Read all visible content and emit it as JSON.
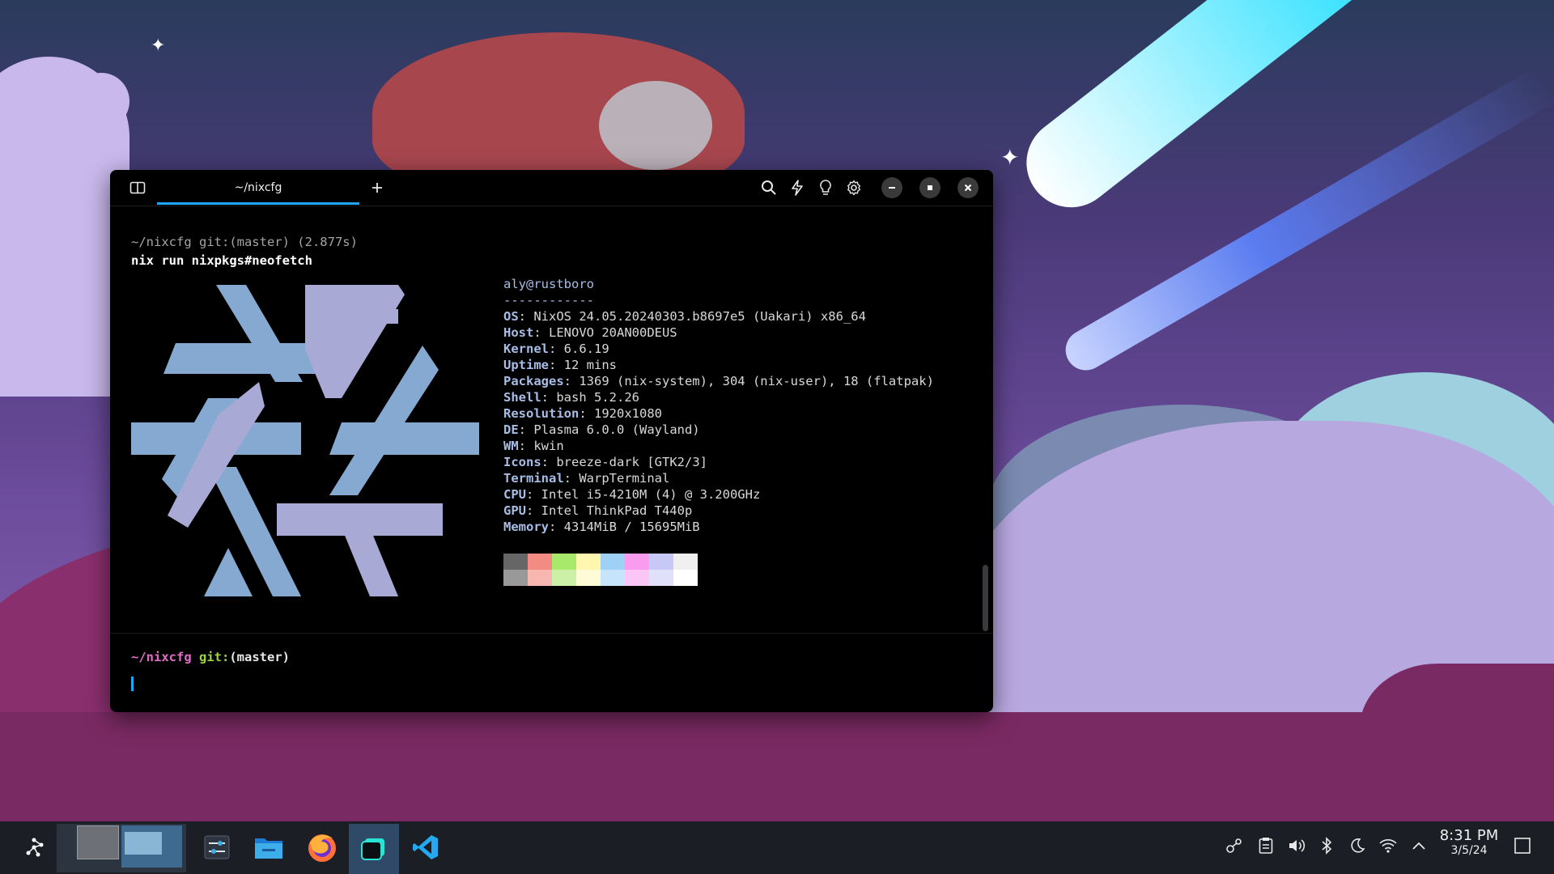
{
  "terminal": {
    "tab_title": "~/nixcfg",
    "previous_block_header": "~/nixcfg git:(master) (2.877s)",
    "command": "nix run nixpkgs#neofetch",
    "info": {
      "header": "aly@rustboro",
      "separator": "------------",
      "rows": [
        {
          "key": "OS",
          "value": "NixOS 24.05.20240303.b8697e5 (Uakari) x86_64"
        },
        {
          "key": "Host",
          "value": "LENOVO 20AN00DEUS"
        },
        {
          "key": "Kernel",
          "value": "6.6.19"
        },
        {
          "key": "Uptime",
          "value": "12 mins"
        },
        {
          "key": "Packages",
          "value": "1369 (nix-system), 304 (nix-user), 18 (flatpak)"
        },
        {
          "key": "Shell",
          "value": "bash 5.2.26"
        },
        {
          "key": "Resolution",
          "value": "1920x1080"
        },
        {
          "key": "DE",
          "value": "Plasma 6.0.0 (Wayland)"
        },
        {
          "key": "WM",
          "value": "kwin"
        },
        {
          "key": "Icons",
          "value": "breeze-dark [GTK2/3]"
        },
        {
          "key": "Terminal",
          "value": "WarpTerminal"
        },
        {
          "key": "CPU",
          "value": "Intel i5-4210M (4) @ 3.200GHz"
        },
        {
          "key": "GPU",
          "value": "Intel ThinkPad T440p"
        },
        {
          "key": "Memory",
          "value": "4314MiB / 15695MiB"
        }
      ],
      "palette": [
        "#666666",
        "#f28b82",
        "#a8e86b",
        "#fff7b0",
        "#9fd1f7",
        "#f99cf0",
        "#c8c8f7",
        "#f0f0f0",
        "#999999",
        "#f7b7b0",
        "#cdf0a8",
        "#fffbd6",
        "#c6e4fb",
        "#fbc6f6",
        "#e0e0fb",
        "#ffffff"
      ]
    },
    "prompt": {
      "dir": "~/nixcfg",
      "git": "git:",
      "branch": "(master)"
    },
    "logo_colors": {
      "light_blue": "#86a9d1",
      "lavender": "#a9a9d6"
    }
  },
  "taskbar": {
    "clock_time": "8:31 PM",
    "clock_date": "3/5/24",
    "apps": [
      "application-launcher-icon",
      "desktop-pager-icon",
      "system-settings-icon",
      "file-manager-icon",
      "firefox-icon",
      "warp-terminal-icon",
      "vscode-icon"
    ],
    "tray": [
      "kde-connect-icon",
      "clipboard-icon",
      "volume-icon",
      "bluetooth-icon",
      "night-color-icon",
      "wifi-icon",
      "tray-expand-icon",
      "show-desktop-icon"
    ]
  }
}
